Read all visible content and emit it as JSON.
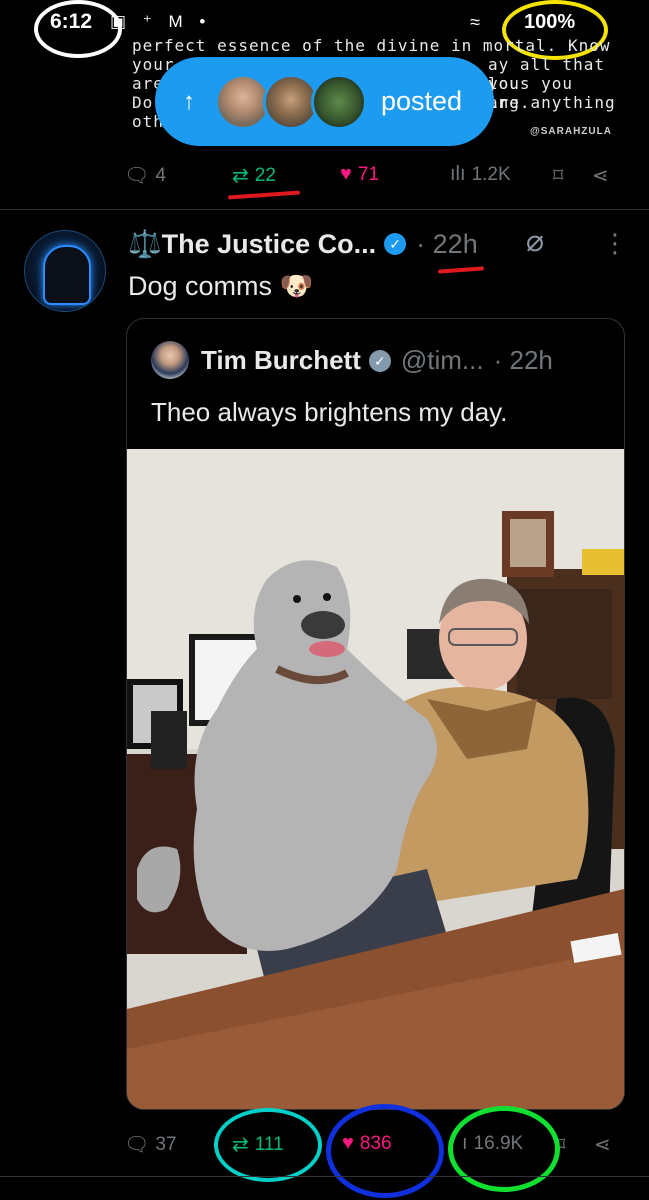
{
  "status_bar": {
    "time": "6:12",
    "battery": "100%",
    "icons": "▣ ⁺ M •",
    "wifi": "≈"
  },
  "prev_post": {
    "image_text": [
      "perfect essence of the divine in mortal. Know",
      "your",
      "are",
      "Do",
      "othe"
    ],
    "image_text_right": [
      "ay all that you",
      "lous you are.",
      "ing anything"
    ],
    "watermark": "@SARAHZULA",
    "actions": {
      "reply": "4",
      "repost": "22",
      "like": "71",
      "views": "1.2K"
    }
  },
  "posted_pill": {
    "label": "posted",
    "arrow": "↑"
  },
  "tweet": {
    "author": "⚖️The Justice Co...",
    "time": "· 22h",
    "text": "Dog comms 🐶",
    "quote": {
      "author": "Tim Burchett",
      "handle": "@tim...",
      "time": "· 22h",
      "text": "Theo always brightens my day."
    },
    "actions": {
      "reply": "37",
      "repost": "111",
      "like": "836",
      "views": "16.9K"
    }
  },
  "colors": {
    "accent": "#1d9bf0",
    "repost": "#00ba7c",
    "like": "#f91880",
    "muted": "#71767b"
  }
}
